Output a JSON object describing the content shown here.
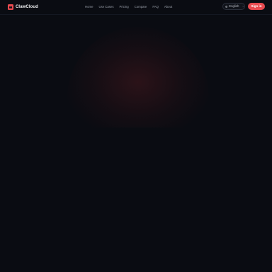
{
  "brand": {
    "name": "ClawCloud",
    "accent": "#e84a4f"
  },
  "nav": {
    "items": [
      {
        "label": "Home"
      },
      {
        "label": "Use Cases"
      },
      {
        "label": "Pricing"
      },
      {
        "label": "Compare"
      },
      {
        "label": "FAQ"
      },
      {
        "label": "About"
      }
    ]
  },
  "language": {
    "label": "English",
    "icon": "globe-icon"
  },
  "auth": {
    "signin_label": "Sign in"
  },
  "colors": {
    "background": "#0a0c12",
    "nav_text": "#9aa0aa",
    "button": "#e84a4f"
  }
}
